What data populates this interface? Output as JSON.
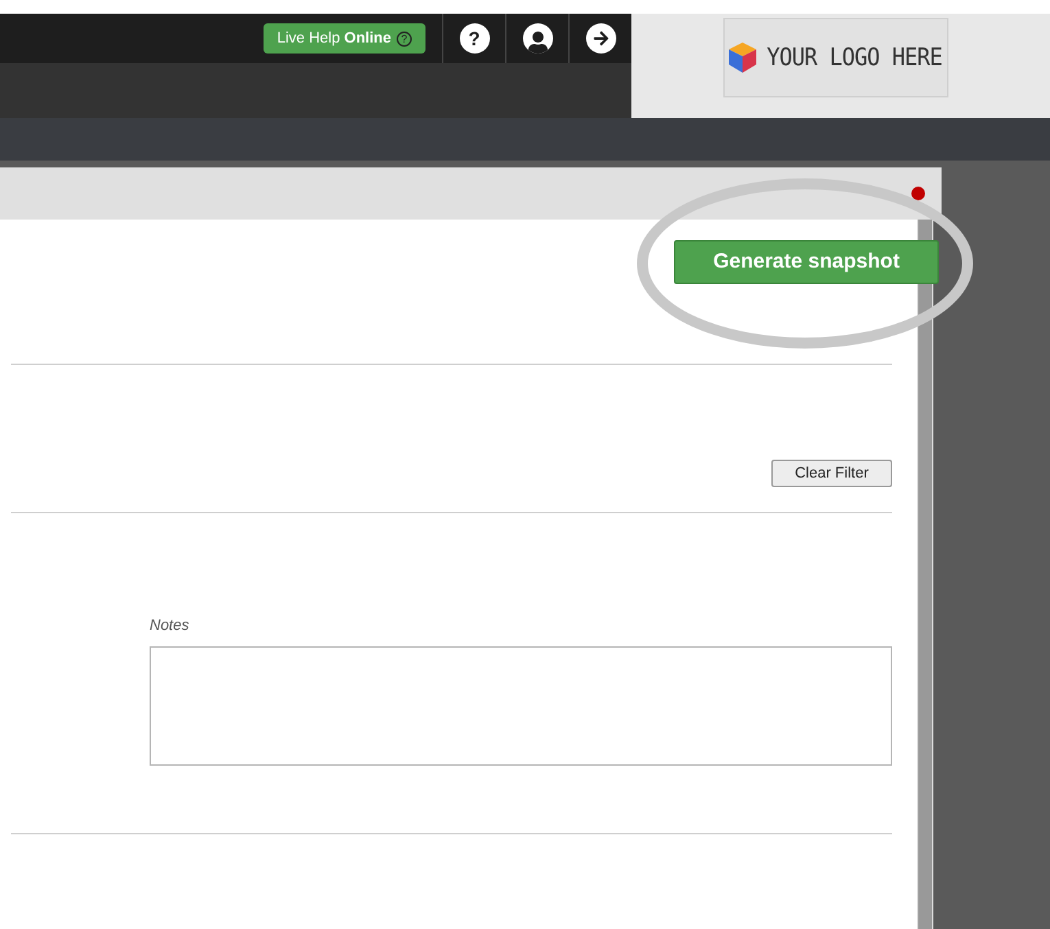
{
  "top_bar": {
    "live_help": "Live Help **Online**",
    "live_help_icon": "?",
    "help_icon": "?"
  },
  "logo": {
    "text": "YOUR LOGO HERE"
  },
  "panel": {
    "alert_dot": {
      "color": "#c00000"
    },
    "generate_button": "Generate snapshot",
    "clear_filter_button": "Clear Filter",
    "notes_label": "Notes",
    "highlighted": true
  }
}
